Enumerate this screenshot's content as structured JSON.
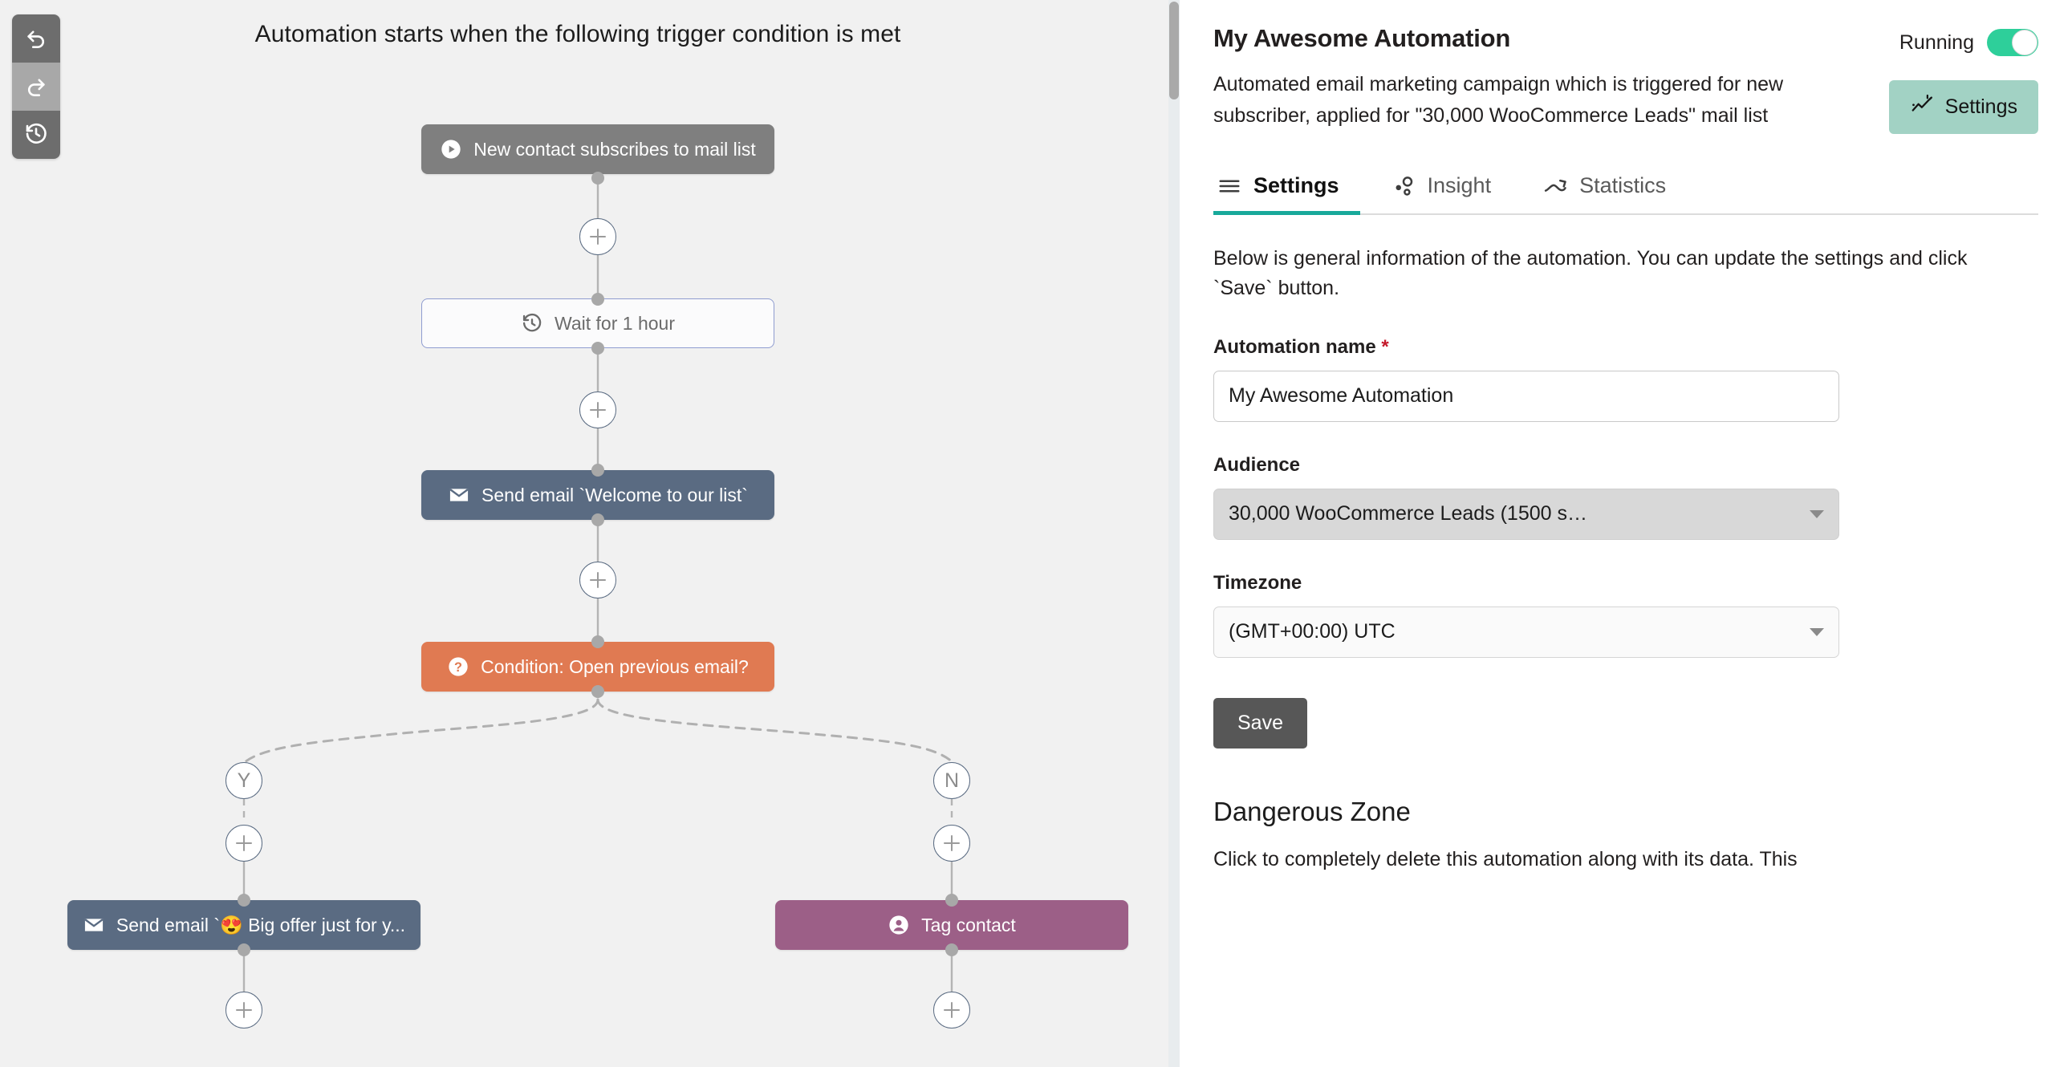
{
  "canvas": {
    "title": "Automation starts when the following trigger condition is met",
    "history_toolbar": [
      {
        "name": "undo-button",
        "icon": "undo-icon"
      },
      {
        "name": "redo-button",
        "icon": "redo-icon"
      },
      {
        "name": "history-button",
        "icon": "clock-history-icon"
      }
    ],
    "nodes": [
      {
        "id": "trigger",
        "label": "New contact subscribes to mail list",
        "icon": "play-circle-icon",
        "type": "trigger"
      },
      {
        "id": "wait",
        "label": "Wait for 1 hour",
        "icon": "clock-rotate-icon",
        "type": "wait"
      },
      {
        "id": "email1",
        "label": "Send email `Welcome to our list`",
        "icon": "envelope-icon",
        "type": "email"
      },
      {
        "id": "cond",
        "label": "Condition: Open previous email?",
        "icon": "question-circle-icon",
        "type": "cond"
      },
      {
        "id": "email2",
        "label": "Send email `😍 Big offer just for y...",
        "icon": "envelope-icon",
        "type": "email"
      },
      {
        "id": "tag",
        "label": "Tag contact",
        "icon": "user-circle-icon",
        "type": "tag"
      }
    ],
    "branch_labels": {
      "yes": "Y",
      "no": "N"
    },
    "add_button_label": "+"
  },
  "panel": {
    "title": "My Awesome Automation",
    "description": "Automated email marketing campaign which is triggered for new subscriber, applied for \"30,000 WooCommerce Leads\" mail list",
    "running_label": "Running",
    "running_on": true,
    "settings_button": "Settings",
    "tabs": [
      {
        "label": "Settings",
        "icon": "hamburger-icon",
        "active": true
      },
      {
        "label": "Insight",
        "icon": "insight-icon",
        "active": false
      },
      {
        "label": "Statistics",
        "icon": "chart-line-icon",
        "active": false
      }
    ],
    "intro": "Below is general information of the automation. You can update the settings and click `Save` button.",
    "form": {
      "name_label": "Automation name",
      "name_required_mark": "*",
      "name_value": "My Awesome Automation",
      "audience_label": "Audience",
      "audience_value": "30,000 WooCommerce Leads (1500 s…",
      "timezone_label": "Timezone",
      "timezone_value": "(GMT+00:00) UTC",
      "save_label": "Save"
    },
    "danger": {
      "title": "Dangerous Zone",
      "text": "Click to completely delete this automation along with its data. This"
    }
  },
  "colors": {
    "accent_teal": "#18a99a",
    "toggle_on": "#2ecf9a",
    "settings_btn": "#a2d2c4",
    "trigger_node": "#7f7f7f",
    "email_node": "#5a6b82",
    "condition_node": "#e07a52",
    "tag_node": "#9c5f87",
    "wait_border": "#8f9cd0",
    "required_red": "#c4192b",
    "canvas_bg": "#f1f1f1"
  }
}
